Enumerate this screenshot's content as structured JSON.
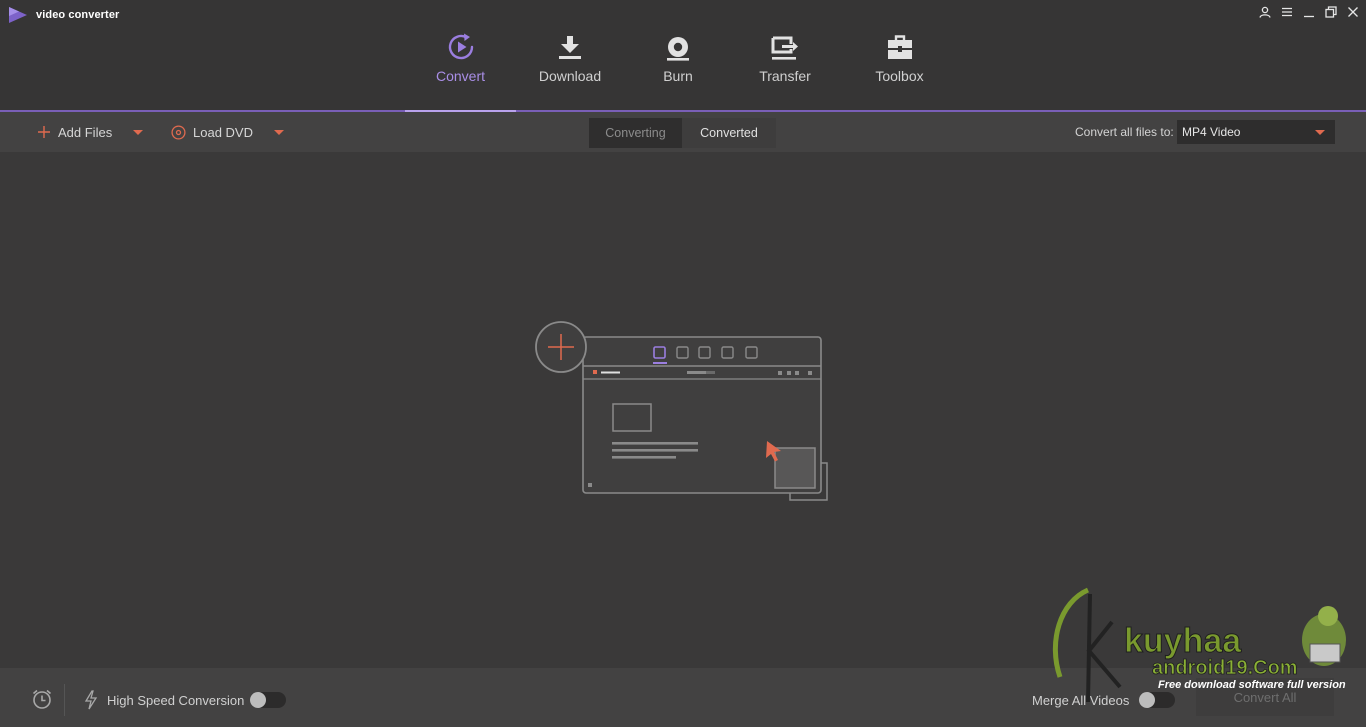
{
  "app": {
    "title": "video converter"
  },
  "nav": {
    "items": [
      {
        "label": "Convert",
        "icon": "convert-icon",
        "active": true
      },
      {
        "label": "Download",
        "icon": "download-icon",
        "active": false
      },
      {
        "label": "Burn",
        "icon": "burn-disc-icon",
        "active": false
      },
      {
        "label": "Transfer",
        "icon": "transfer-icon",
        "active": false
      },
      {
        "label": "Toolbox",
        "icon": "toolbox-icon",
        "active": false
      }
    ]
  },
  "toolbar": {
    "add_files": "Add Files",
    "load_dvd": "Load DVD",
    "tabs": [
      {
        "label": "Converting",
        "active": false
      },
      {
        "label": "Converted",
        "active": true
      }
    ],
    "convert_all_label": "Convert all files to:",
    "format_value": "MP4 Video"
  },
  "bottom": {
    "high_speed_label": "High Speed Conversion",
    "high_speed_on": false,
    "merge_label": "Merge All Videos",
    "merge_on": false,
    "convert_all_button": "Convert All"
  },
  "watermark": {
    "brand": "kuyhaa",
    "domain": "android19.Com",
    "tagline": "Free download software full version"
  },
  "colors": {
    "accent_purple": "#9b7ee0",
    "accent_orange": "#e06a4f",
    "background": "#3a3939"
  }
}
